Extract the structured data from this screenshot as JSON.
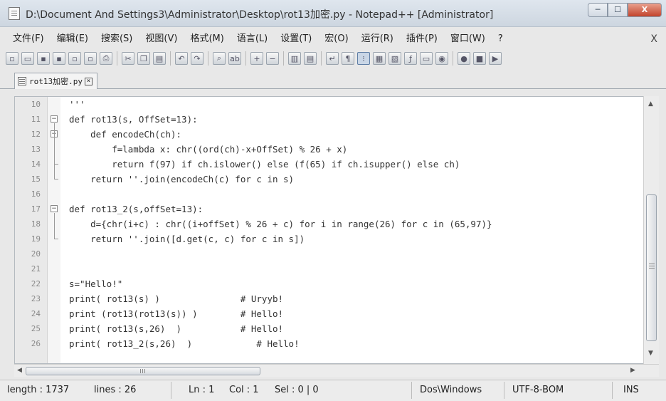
{
  "window": {
    "title": "D:\\Document And Settings3\\Administrator\\Desktop\\rot13加密.py - Notepad++ [Administrator]",
    "controls": {
      "minimize": "─",
      "maximize": "☐",
      "close": "X"
    }
  },
  "menu": {
    "items": [
      "文件(F)",
      "编辑(E)",
      "搜索(S)",
      "视图(V)",
      "格式(M)",
      "语言(L)",
      "设置(T)",
      "宏(O)",
      "运行(R)",
      "插件(P)",
      "窗口(W)",
      "?"
    ],
    "close_label": "X"
  },
  "toolbar": {
    "buttons": [
      {
        "name": "new-file-icon",
        "glyph": "▫"
      },
      {
        "name": "open-file-icon",
        "glyph": "▭"
      },
      {
        "name": "save-icon",
        "glyph": "▪"
      },
      {
        "name": "save-all-icon",
        "glyph": "▪"
      },
      {
        "name": "close-file-icon",
        "glyph": "▫"
      },
      {
        "name": "close-all-icon",
        "glyph": "▫"
      },
      {
        "name": "print-icon",
        "glyph": "⎙"
      },
      {
        "name": "sep"
      },
      {
        "name": "cut-icon",
        "glyph": "✂"
      },
      {
        "name": "copy-icon",
        "glyph": "❐"
      },
      {
        "name": "paste-icon",
        "glyph": "▤"
      },
      {
        "name": "sep"
      },
      {
        "name": "undo-icon",
        "glyph": "↶"
      },
      {
        "name": "redo-icon",
        "glyph": "↷"
      },
      {
        "name": "sep"
      },
      {
        "name": "find-icon",
        "glyph": "⌕"
      },
      {
        "name": "replace-icon",
        "glyph": "ab"
      },
      {
        "name": "sep"
      },
      {
        "name": "zoom-in-icon",
        "glyph": "+"
      },
      {
        "name": "zoom-out-icon",
        "glyph": "−"
      },
      {
        "name": "sep"
      },
      {
        "name": "sync-vertical-icon",
        "glyph": "▥"
      },
      {
        "name": "sync-horizontal-icon",
        "glyph": "▤"
      },
      {
        "name": "sep"
      },
      {
        "name": "word-wrap-icon",
        "glyph": "↵"
      },
      {
        "name": "show-all-chars-icon",
        "glyph": "¶"
      },
      {
        "name": "indent-guide-icon",
        "glyph": "⁝",
        "active": true
      },
      {
        "name": "user-language-icon",
        "glyph": "▦"
      },
      {
        "name": "doc-map-icon",
        "glyph": "▧"
      },
      {
        "name": "function-list-icon",
        "glyph": "ƒ"
      },
      {
        "name": "folder-workspace-icon",
        "glyph": "▭"
      },
      {
        "name": "monitoring-icon",
        "glyph": "◉"
      },
      {
        "name": "sep"
      },
      {
        "name": "record-macro-icon",
        "glyph": "●"
      },
      {
        "name": "stop-macro-icon",
        "glyph": "■"
      },
      {
        "name": "play-macro-icon",
        "glyph": "▶"
      }
    ]
  },
  "tab": {
    "label": "rot13加密.py",
    "close": "×"
  },
  "editor": {
    "lines": [
      {
        "num": "10",
        "text": "'''"
      },
      {
        "num": "11",
        "text": "def rot13(s, OffSet=13):"
      },
      {
        "num": "12",
        "text": "    def encodeCh(ch):"
      },
      {
        "num": "13",
        "text": "        f=lambda x: chr((ord(ch)-x+OffSet) % 26 + x)"
      },
      {
        "num": "14",
        "text": "        return f(97) if ch.islower() else (f(65) if ch.isupper() else ch)"
      },
      {
        "num": "15",
        "text": "    return ''.join(encodeCh(c) for c in s)"
      },
      {
        "num": "16",
        "text": ""
      },
      {
        "num": "17",
        "text": "def rot13_2(s,offSet=13):"
      },
      {
        "num": "18",
        "text": "    d={chr(i+c) : chr((i+offSet) % 26 + c) for i in range(26) for c in (65,97)}"
      },
      {
        "num": "19",
        "text": "    return ''.join([d.get(c, c) for c in s])"
      },
      {
        "num": "20",
        "text": ""
      },
      {
        "num": "21",
        "text": ""
      },
      {
        "num": "22",
        "text": "s=\"Hello!\""
      },
      {
        "num": "23",
        "text": "print( rot13(s) )               # Uryyb!"
      },
      {
        "num": "24",
        "text": "print (rot13(rot13(s)) )        # Hello!"
      },
      {
        "num": "25",
        "text": "print( rot13(s,26)  )           # Hello!"
      },
      {
        "num": "26",
        "text": "print( rot13_2(s,26)  )            # Hello!"
      }
    ]
  },
  "status": {
    "length": "length : 1737",
    "lines": "lines : 26",
    "ln": "Ln : 1",
    "col": "Col : 1",
    "sel": "Sel : 0 | 0",
    "eol": "Dos\\Windows",
    "encoding": "UTF-8-BOM",
    "mode": "INS"
  }
}
